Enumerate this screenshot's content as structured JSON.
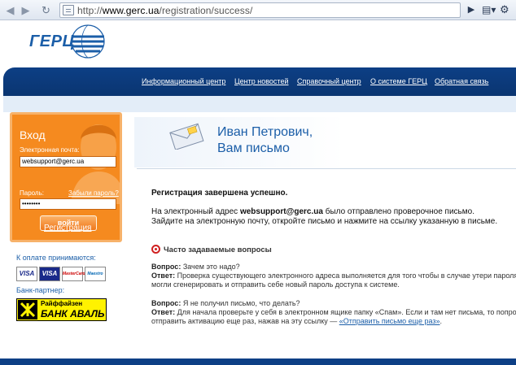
{
  "browser": {
    "url_prefix": "http://",
    "url_domain": "www.gerc.ua",
    "url_path": "/registration/success/"
  },
  "site": {
    "logo_text": "ГЕРЦ",
    "nav": [
      {
        "label": "Информационный центр"
      },
      {
        "label": "Центр новостей"
      },
      {
        "label": "Справочный центр"
      },
      {
        "label": "О системе ГЕРЦ"
      },
      {
        "label": "Обратная связь"
      }
    ]
  },
  "login": {
    "title": "Вход",
    "email_label": "Электронная почта:",
    "email_value": "websupport@gerc.ua",
    "password_label": "Пароль:",
    "password_value": "••••••••",
    "forgot_label": "Забыли пароль?",
    "submit_label": "войти",
    "register_label": "Регистрация"
  },
  "payment": {
    "label": "К оплате принимаются:",
    "cards": [
      "VISA",
      "VISA",
      "MasterCard",
      "Maestro"
    ]
  },
  "partner": {
    "label": "Банк-партнер:",
    "line1": "Райффайзен",
    "line2": "БАНК АВАЛЬ"
  },
  "hero": {
    "line1": "Иван Петрович,",
    "line2": "Вам письмо"
  },
  "message": {
    "success": "Регистрация завершена успешно.",
    "p1_before": "На электронный адрес ",
    "p1_email": "websupport@gerc.ua",
    "p1_after": " было отправлено проверочное письмо.",
    "p2": "Зайдите на электронную почту, откройте письмо и нажмите на ссылку указанную в письме."
  },
  "faq": {
    "title": "Часто задаваемые вопросы",
    "q1_label": "Вопрос:",
    "q1": " Зачем это надо?",
    "a1_label": "Ответ:",
    "a1_line1": " Проверка существующего электронного адреса выполняется для того чтобы в случае утери пароля",
    "a1_line2": "могли сгенерировать и отправить себе новый пароль доступа к системе.",
    "q2_label": "Вопрос:",
    "q2": " Я не получил письмо, что делать?",
    "a2_label": "Ответ:",
    "a2_line1": " Для начала проверьте у себя в электронном ящике папку «Спам». Если и там нет письма, то попро",
    "a2_line2": "отправить активацию еще раз, нажав на эту ссылку — ",
    "a2_link": "«Отправить письмо еще раз»",
    "a2_end": "."
  }
}
